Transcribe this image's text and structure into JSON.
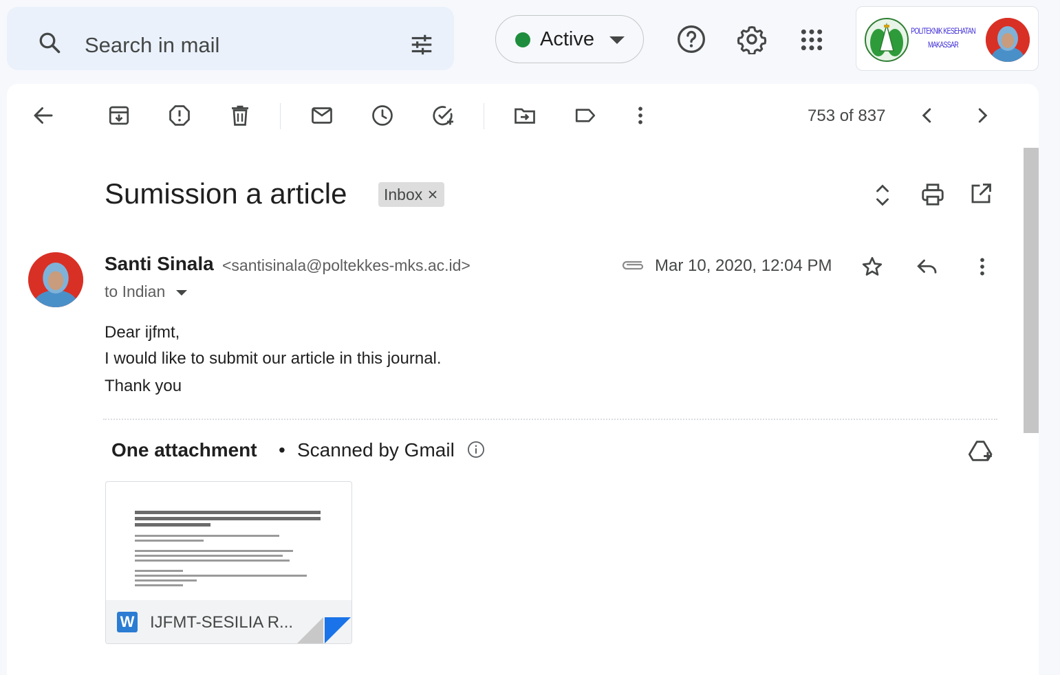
{
  "search": {
    "placeholder": "Search in mail"
  },
  "status": {
    "label": "Active",
    "color": "#1e8e3e"
  },
  "account": {
    "org_name": "POLITEKNIK KESEHATAN MAKASSAR"
  },
  "toolbar": {
    "counter": "753 of 837"
  },
  "email": {
    "subject": "Sumission a article",
    "label_chip": "Inbox",
    "sender_name": "Santi Sinala",
    "sender_email": "<santisinala@poltekkes-mks.ac.id>",
    "to_line": "to Indian",
    "date": "Mar 10, 2020, 12:04 PM",
    "body": [
      "Dear ijfmt,",
      "I would like to submit our article in this journal.",
      "Thank you"
    ]
  },
  "attachments": {
    "title": "One attachment",
    "separator": "•",
    "scanned": "Scanned by Gmail",
    "file_name": "IJFMT-SESILIA R...",
    "file_type_letter": "W",
    "file_type_color": "#2b7cd3"
  },
  "icons": [
    "search-icon",
    "tune-icon",
    "chevron-down-icon",
    "help-icon",
    "gear-icon",
    "apps-icon",
    "back-arrow-icon",
    "archive-icon",
    "report-spam-icon",
    "trash-icon",
    "mark-unread-icon",
    "snooze-icon",
    "add-task-icon",
    "move-to-icon",
    "label-icon",
    "more-vert-icon",
    "chevron-left-icon",
    "chevron-right-icon",
    "expand-collapse-icon",
    "print-icon",
    "open-new-window-icon",
    "paperclip-icon",
    "star-icon",
    "reply-icon",
    "info-icon",
    "add-to-drive-icon",
    "word-doc-icon",
    "close-icon"
  ]
}
